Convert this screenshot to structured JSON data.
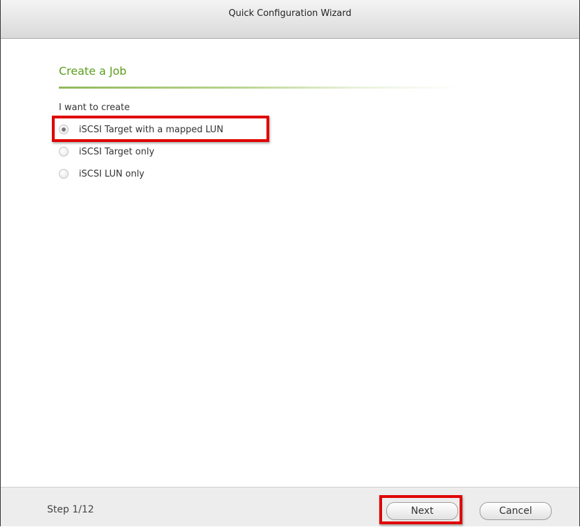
{
  "window": {
    "title": "Quick Configuration Wizard"
  },
  "section": {
    "title": "Create a Job",
    "prompt": "I want to create"
  },
  "options": [
    {
      "label": "iSCSI Target with a mapped LUN",
      "selected": true
    },
    {
      "label": "iSCSI Target only",
      "selected": false
    },
    {
      "label": "iSCSI LUN only",
      "selected": false
    }
  ],
  "footer": {
    "step": "Step 1/12",
    "next_label": "Next",
    "cancel_label": "Cancel"
  },
  "colors": {
    "accent_green": "#5a9e1b",
    "highlight_red": "#e00000"
  }
}
